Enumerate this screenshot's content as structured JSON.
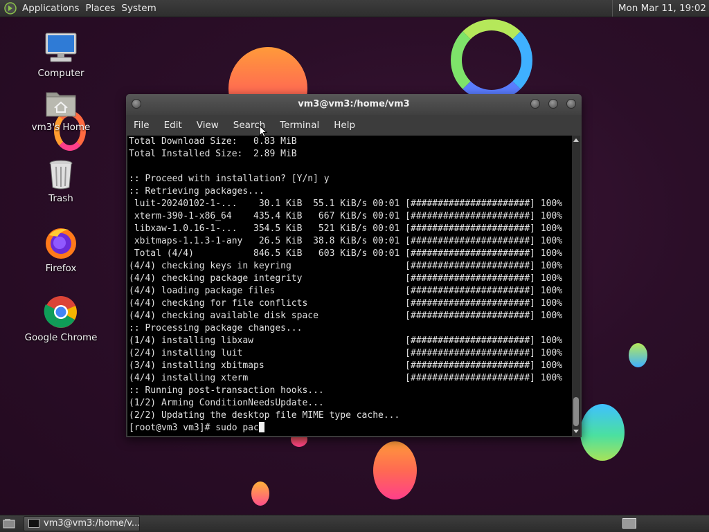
{
  "top_panel": {
    "menus": [
      "Applications",
      "Places",
      "System"
    ],
    "clock": "Mon Mar 11, 19:02"
  },
  "desktop_icons": [
    {
      "label": "Computer",
      "icon": "computer-icon"
    },
    {
      "label": "vm3's Home",
      "icon": "home-folder-icon"
    },
    {
      "label": "Trash",
      "icon": "trash-icon"
    },
    {
      "label": "Firefox",
      "icon": "firefox-icon"
    },
    {
      "label": "Google Chrome",
      "icon": "chrome-icon"
    }
  ],
  "terminal": {
    "title": "vm3@vm3:/home/vm3",
    "menu": [
      "File",
      "Edit",
      "View",
      "Search",
      "Terminal",
      "Help"
    ],
    "lines": [
      "Total Download Size:   0.83 MiB",
      "Total Installed Size:  2.89 MiB",
      "",
      ":: Proceed with installation? [Y/n] y",
      ":: Retrieving packages...",
      " luit-20240102-1-...    30.1 KiB  55.1 KiB/s 00:01 [######################] 100%",
      " xterm-390-1-x86_64    435.4 KiB   667 KiB/s 00:01 [######################] 100%",
      " libxaw-1.0.16-1-...   354.5 KiB   521 KiB/s 00:01 [######################] 100%",
      " xbitmaps-1.1.3-1-any   26.5 KiB  38.8 KiB/s 00:01 [######################] 100%",
      " Total (4/4)           846.5 KiB   603 KiB/s 00:01 [######################] 100%",
      "(4/4) checking keys in keyring                     [######################] 100%",
      "(4/4) checking package integrity                   [######################] 100%",
      "(4/4) loading package files                        [######################] 100%",
      "(4/4) checking for file conflicts                  [######################] 100%",
      "(4/4) checking available disk space                [######################] 100%",
      ":: Processing package changes...",
      "(1/4) installing libxaw                            [######################] 100%",
      "(2/4) installing luit                              [######################] 100%",
      "(3/4) installing xbitmaps                          [######################] 100%",
      "(4/4) installing xterm                             [######################] 100%",
      ":: Running post-transaction hooks...",
      "(1/2) Arming ConditionNeedsUpdate...",
      "(2/2) Updating the desktop file MIME type cache..."
    ],
    "prompt": "[root@vm3 vm3]# sudo pac"
  },
  "taskbar": {
    "task_label": "vm3@vm3:/home/v..."
  },
  "colors": {
    "desktop_bg": "#2a0f26",
    "panel_bg": "#333333",
    "terminal_bg": "#000000",
    "terminal_fg": "#e0e0e0"
  }
}
